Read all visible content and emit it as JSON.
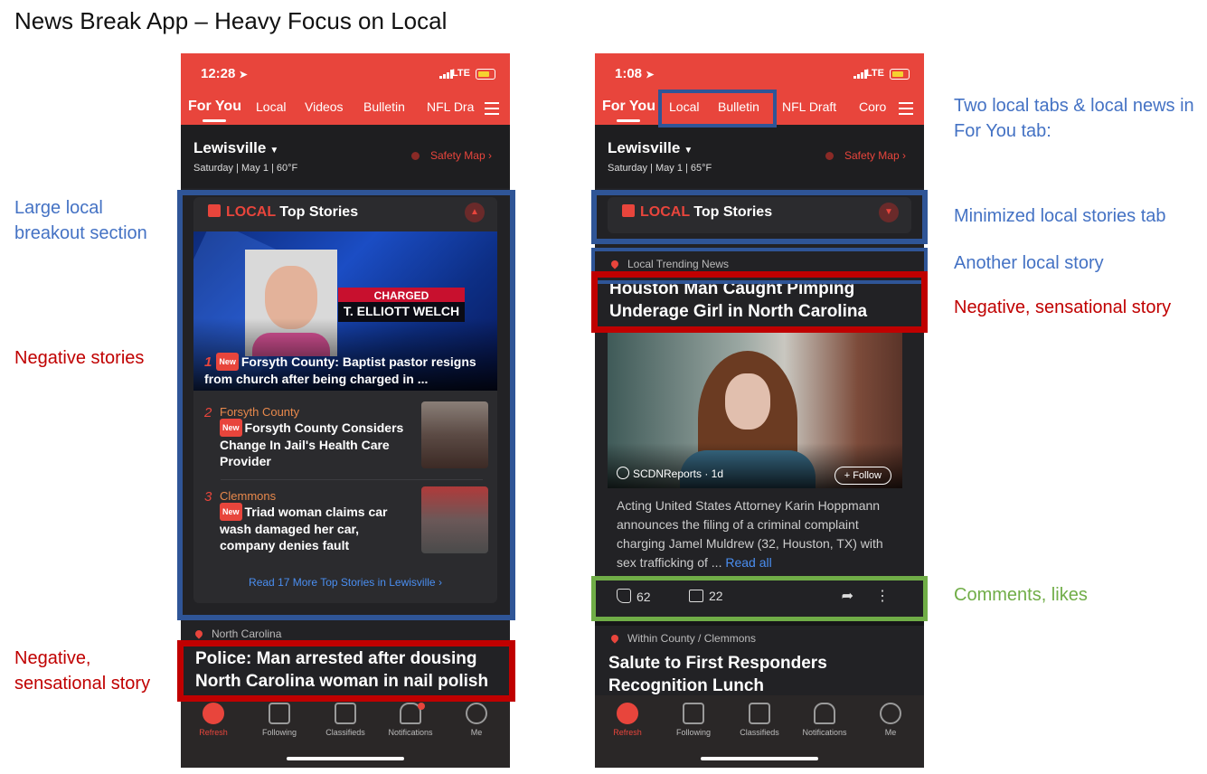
{
  "slide": {
    "title": "News Break App – Heavy Focus on Local"
  },
  "phone1": {
    "time": "12:28",
    "network": "LTE",
    "tabs": [
      "For You",
      "Local",
      "Videos",
      "Bulletin",
      "NFL Dra"
    ],
    "location": "Lewisville",
    "date_weather": "Saturday | May 1 | 60°F",
    "safety_map": "Safety Map",
    "local_section": {
      "local_word": "LOCAL",
      "heading": "Top Stories",
      "hero_charged": "CHARGED",
      "hero_name": "T. ELLIOTT WELCH",
      "stories": [
        {
          "num": "1",
          "badge": "New",
          "title": "Forsyth County: Baptist pastor resigns from church after being charged in ..."
        },
        {
          "num": "2",
          "county": "Forsyth County",
          "badge": "New",
          "title": "Forsyth County Considers Change In Jail's Health Care Provider"
        },
        {
          "num": "3",
          "county": "Clemmons",
          "badge": "New",
          "title": "Triad woman claims car wash damaged her car, company denies fault"
        }
      ],
      "read_more": "Read 17 More Top Stories in Lewisville"
    },
    "next_tag": "North Carolina",
    "next_title": "Police: Man arrested after dousing North Carolina woman in nail polish"
  },
  "phone2": {
    "time": "1:08",
    "network": "LTE",
    "tabs": [
      "For You",
      "Local",
      "Bulletin",
      "NFL Draft",
      "Coro"
    ],
    "location": "Lewisville",
    "date_weather": "Saturday | May 1 | 65°F",
    "safety_map": "Safety Map",
    "local_word": "LOCAL",
    "local_heading": "Top Stories",
    "trending_tag": "Local Trending News",
    "story_title": "Houston Man Caught Pimping Underage Girl in North Carolina",
    "source": "SCDNReports · 1d",
    "follow": "+ Follow",
    "summary": "Acting United States Attorney Karin Hoppmann announces the filing of a criminal complaint charging Jamel Muldrew (32, Houston, TX) with sex trafficking of ...",
    "read_all": "Read all",
    "likes": "62",
    "comments": "22",
    "next_tag": "Within County / Clemmons",
    "next_title": "Salute to First Responders Recognition Lunch"
  },
  "nav": [
    "Refresh",
    "Following",
    "Classifieds",
    "Notifications",
    "Me"
  ],
  "annotations": {
    "large_local": "Large local breakout section",
    "negative_stories": "Negative stories",
    "negative_sensational_1": "Negative, sensational story",
    "two_local_tabs": "Two local tabs & local news in For You tab:",
    "minimized_tab": "Minimized local stories tab",
    "another_local": "Another local story",
    "negative_sensational_2": "Negative, sensational story",
    "comments_likes": "Comments, likes"
  },
  "colors": {
    "brand_red": "#e8453c",
    "annotation_blue": "#4472c4",
    "annotation_red": "#c00000",
    "annotation_green": "#70ad47"
  }
}
